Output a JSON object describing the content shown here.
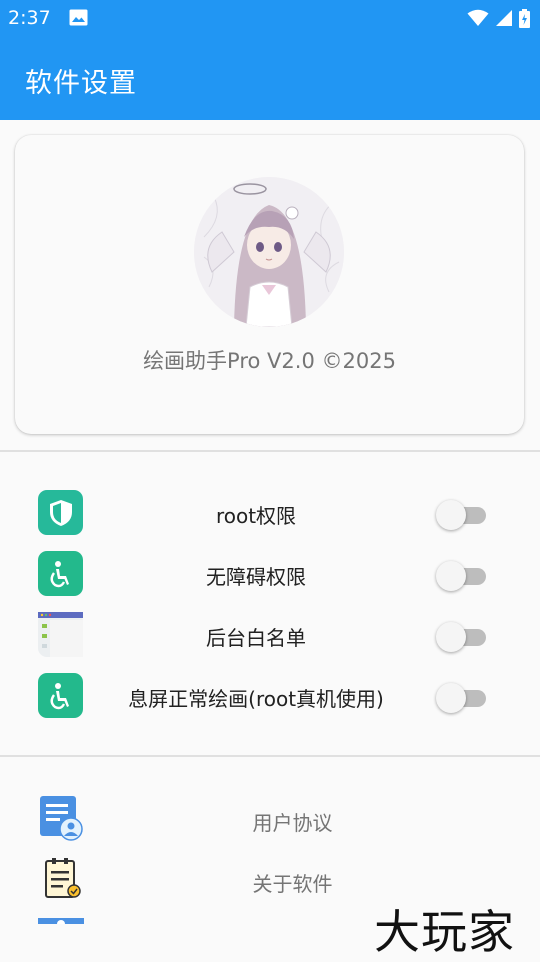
{
  "status": {
    "time": "2:37",
    "icons": [
      "photo-icon",
      "wifi-icon",
      "signal-icon",
      "battery-icon"
    ]
  },
  "app_bar": {
    "title": "软件设置"
  },
  "profile": {
    "caption": "绘画助手Pro V2.0 ©2025",
    "avatar_icon": "anime-avatar"
  },
  "settings": [
    {
      "label": "root权限",
      "icon": "shield-icon",
      "enabled": false
    },
    {
      "label": "无障碍权限",
      "icon": "accessibility-icon",
      "enabled": false
    },
    {
      "label": "后台白名单",
      "icon": "app-window-icon",
      "enabled": false
    },
    {
      "label": "息屏正常绘画(root真机使用)",
      "icon": "accessibility-icon",
      "enabled": false
    }
  ],
  "links": [
    {
      "label": "用户协议",
      "icon": "user-agreement-icon"
    },
    {
      "label": "关于软件",
      "icon": "clipboard-check-icon"
    }
  ],
  "watermark": {
    "text": "大玩家"
  },
  "colors": {
    "primary": "#2196f3",
    "teal": "#26b99a",
    "switch_off": "#bdbdbd"
  }
}
